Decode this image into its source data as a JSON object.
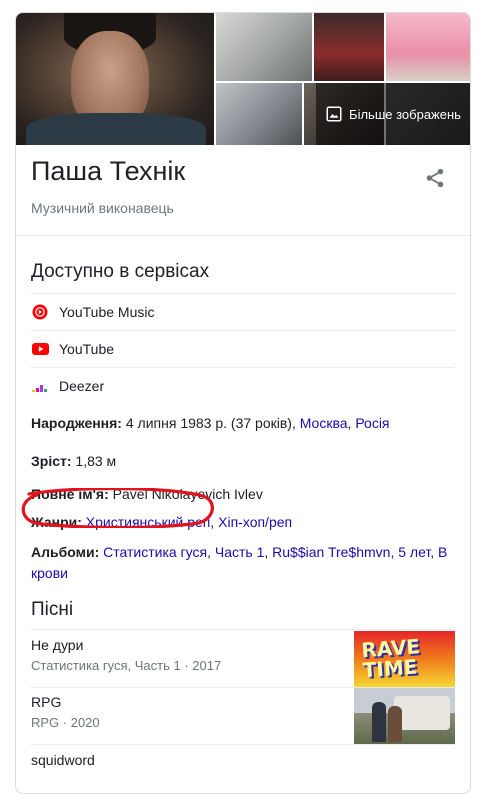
{
  "images": {
    "more_label": "Більше зображень"
  },
  "header": {
    "title": "Паша Технік",
    "subtitle": "Музичний виконавець"
  },
  "services": {
    "title": "Доступно в сервісах",
    "items": [
      {
        "label": "YouTube Music",
        "icon": "youtube-music-icon",
        "color": "#ff0000"
      },
      {
        "label": "YouTube",
        "icon": "youtube-icon",
        "color": "#ff0000"
      },
      {
        "label": "Deezer",
        "icon": "deezer-icon",
        "color": "#a238ff"
      }
    ]
  },
  "facts": {
    "born_label": "Народження:",
    "born_value": "4 липня 1983 р. (37 років),",
    "born_city": "Москва",
    "born_sep": ",",
    "born_country": "Росія",
    "height_label": "Зріст:",
    "height_value": "1,83 м",
    "fullname_label": "Повне ім'я:",
    "fullname_value": "Pavel Nikolayevich Ivlev",
    "genres_label": "Жанри:",
    "genre1": "Християнський реп",
    "genre_sep": ",",
    "genre2": "Хіп-хоп/реп",
    "albums_label": "Альбоми:",
    "albums": [
      "Статистика гуся",
      "Часть 1",
      "Ru$$ian Tre$hmvn",
      "5 лет",
      "В крови"
    ]
  },
  "songs": {
    "title": "Пісні",
    "items": [
      {
        "name": "Не дури",
        "meta": "Статистика гуся, Часть 1 · 2017",
        "thumb_text": "RAVE TIME"
      },
      {
        "name": "RPG",
        "meta": "RPG · 2020"
      },
      {
        "name": "squidword",
        "meta": ""
      }
    ]
  },
  "accent_colors": {
    "link": "#1a0dab",
    "highlight": "#e0141e"
  }
}
